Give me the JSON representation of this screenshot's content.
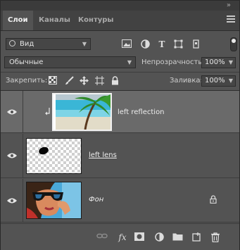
{
  "tabs": [
    {
      "label": "Слои"
    },
    {
      "label": "Каналы"
    },
    {
      "label": "Контуры"
    }
  ],
  "filter": {
    "label": "Вид"
  },
  "blend_mode": "Обычные",
  "opacity": {
    "label": "Непрозрачность:",
    "value": "100%"
  },
  "lock": {
    "label": "Закрепить:"
  },
  "fill": {
    "label": "Заливка:",
    "value": "100%"
  },
  "layers": [
    {
      "name": "left reflection",
      "selected": true,
      "visible": true
    },
    {
      "name": "left lens",
      "selected": false,
      "visible": true
    },
    {
      "name": "Фон",
      "selected": false,
      "visible": true,
      "locked": true
    }
  ],
  "colors": {
    "panel": "#535353",
    "selected_layer": "#6a6a6a",
    "tab_bar": "#424242"
  }
}
